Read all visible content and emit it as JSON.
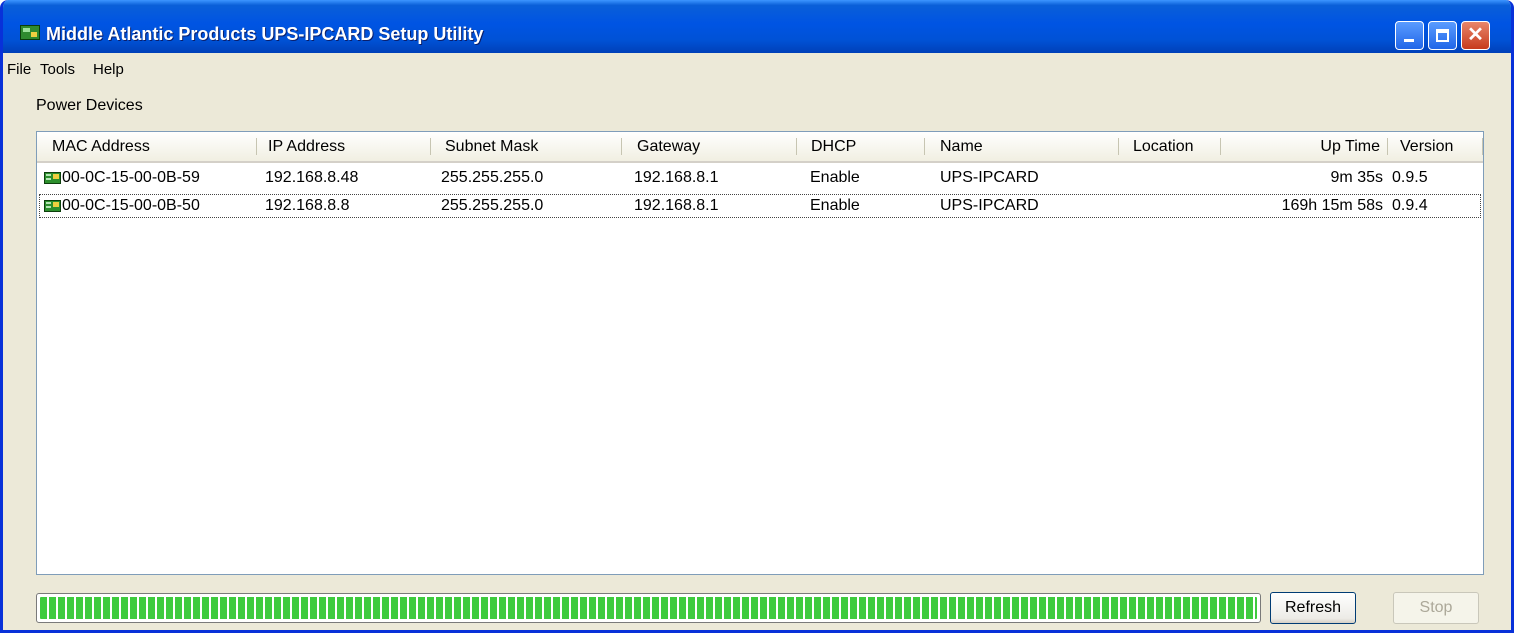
{
  "window": {
    "title": "Middle Atlantic Products UPS-IPCARD Setup Utility",
    "controls": {
      "minimize": "minimize",
      "maximize": "maximize",
      "close": "✕"
    }
  },
  "menu": [
    "File",
    "Tools",
    "Help"
  ],
  "group_label": "Power Devices",
  "columns": {
    "mac": "MAC Address",
    "ip": "IP Address",
    "subnet": "Subnet Mask",
    "gateway": "Gateway",
    "dhcp": "DHCP",
    "name": "Name",
    "location": "Location",
    "uptime": "Up Time",
    "version": "Version"
  },
  "rows": [
    {
      "icon": "network-card-icon",
      "mac": "00-0C-15-00-0B-59",
      "ip": "192.168.8.48",
      "subnet": "255.255.255.0",
      "gateway": "192.168.8.1",
      "dhcp": "Enable",
      "name": "UPS-IPCARD",
      "location": "",
      "uptime": "9m 35s",
      "version": "0.9.5"
    },
    {
      "icon": "network-card-icon",
      "mac": "00-0C-15-00-0B-50",
      "ip": "192.168.8.8",
      "subnet": "255.255.255.0",
      "gateway": "192.168.8.1",
      "dhcp": "Enable",
      "name": "UPS-IPCARD",
      "location": "",
      "uptime": "169h 15m 58s",
      "version": "0.9.4"
    }
  ],
  "progress": {
    "percent": 100,
    "color": "#3ecb3e"
  },
  "buttons": {
    "refresh": "Refresh",
    "stop": "Stop"
  }
}
